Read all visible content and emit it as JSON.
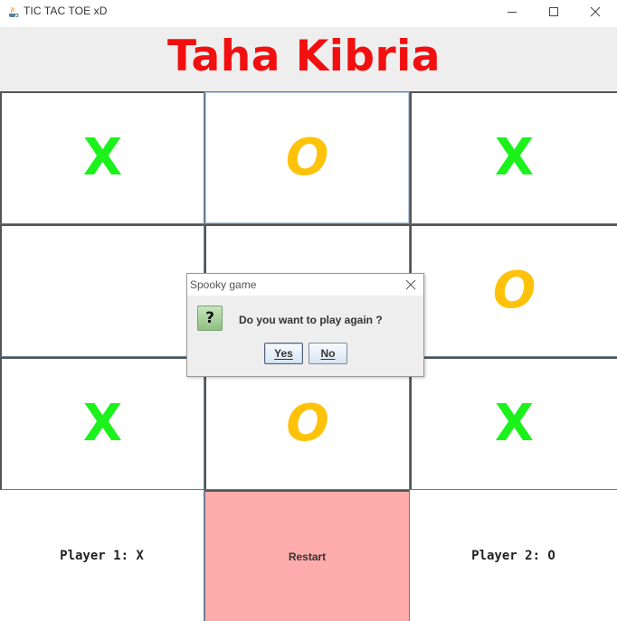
{
  "window": {
    "title": "TIC TAC TOE xD",
    "icons": [
      "java-app-icon",
      "minimize-icon",
      "maximize-icon",
      "close-icon"
    ]
  },
  "header": {
    "title": "Taha Kibria",
    "color": "#f10f0f"
  },
  "board": {
    "cells": [
      {
        "value": "X",
        "mark": "x"
      },
      {
        "value": "O",
        "mark": "o"
      },
      {
        "value": "X",
        "mark": "x"
      },
      {
        "value": "",
        "mark": "empty"
      },
      {
        "value": "",
        "mark": "empty"
      },
      {
        "value": "O",
        "mark": "o"
      },
      {
        "value": "X",
        "mark": "x"
      },
      {
        "value": "O",
        "mark": "o"
      },
      {
        "value": "X",
        "mark": "x"
      }
    ],
    "x_color": "#1bf21b",
    "o_color": "#ffc20a"
  },
  "footer": {
    "player1": "Player 1: X",
    "restart": "Restart",
    "player2": "Player 2: O",
    "restart_color": "#ffacac"
  },
  "dialog": {
    "title": "Spooky game",
    "message": "Do you want to play again ?",
    "icon": "question-icon",
    "icon_text": "?",
    "yes": "Yes",
    "no": "No"
  }
}
